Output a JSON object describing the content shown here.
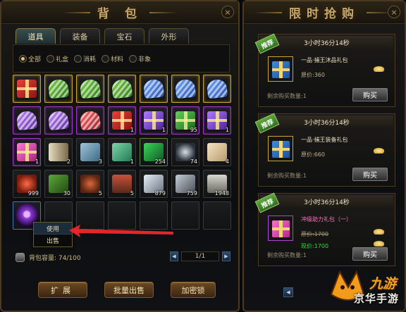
{
  "bag": {
    "title": "背 包",
    "close_label": "×",
    "tabs": [
      {
        "label": "道具",
        "active": true
      },
      {
        "label": "装备",
        "active": false
      },
      {
        "label": "宝石",
        "active": false
      },
      {
        "label": "外形",
        "active": false
      }
    ],
    "filters": [
      {
        "label": "全部",
        "selected": true
      },
      {
        "label": "礼盒",
        "selected": false
      },
      {
        "label": "消耗",
        "selected": false
      },
      {
        "label": "材料",
        "selected": false
      },
      {
        "label": "非象",
        "selected": false
      }
    ],
    "slots": [
      {
        "icon": "red-gift-box-icon",
        "quality": "gold",
        "count": ""
      },
      {
        "icon": "green-heart-gift-icon",
        "quality": "gold",
        "count": ""
      },
      {
        "icon": "green-heart-gift-icon",
        "quality": "gold",
        "count": ""
      },
      {
        "icon": "green-heart-gift-icon",
        "quality": "gold",
        "count": ""
      },
      {
        "icon": "blue-heart-gift-icon",
        "quality": "gold",
        "count": ""
      },
      {
        "icon": "blue-heart-gift-icon",
        "quality": "gold",
        "count": ""
      },
      {
        "icon": "blue-heart-gift-icon",
        "quality": "gold",
        "count": ""
      },
      {
        "icon": "purple-heart-gift-icon",
        "quality": "purple",
        "count": ""
      },
      {
        "icon": "purple-heart-gift-icon",
        "quality": "purple",
        "count": ""
      },
      {
        "icon": "red-heart-gift-icon",
        "quality": "purple",
        "count": ""
      },
      {
        "icon": "red-gift-box-icon",
        "quality": "purple",
        "count": "1"
      },
      {
        "icon": "purple-gift-box-icon",
        "quality": "purple",
        "count": "1"
      },
      {
        "icon": "green-gift-box-icon",
        "quality": "purple",
        "count": "95"
      },
      {
        "icon": "purple-gift-box-icon",
        "quality": "purple",
        "count": "1"
      },
      {
        "icon": "pink-gift-box-icon",
        "quality": "purple",
        "count": "1"
      },
      {
        "icon": "horn-icon",
        "quality": "none",
        "count": "2"
      },
      {
        "icon": "blue-tag-icon",
        "quality": "none",
        "count": "3"
      },
      {
        "icon": "green-ticket-icon",
        "quality": "none",
        "count": "1"
      },
      {
        "icon": "exp-scroll-icon",
        "quality": "green",
        "count": "254"
      },
      {
        "icon": "dark-orb-icon",
        "quality": "none",
        "count": "74"
      },
      {
        "icon": "letter-icon",
        "quality": "none",
        "count": "4"
      },
      {
        "icon": "red-berries-icon",
        "quality": "none",
        "count": "999"
      },
      {
        "icon": "herb-icon",
        "quality": "none",
        "count": "30"
      },
      {
        "icon": "fruit-icon",
        "quality": "none",
        "count": "5"
      },
      {
        "icon": "mushroom-icon",
        "quality": "none",
        "count": "5"
      },
      {
        "icon": "silver-ore-icon",
        "quality": "none",
        "count": "879"
      },
      {
        "icon": "iron-ore-icon",
        "quality": "none",
        "count": "759"
      },
      {
        "icon": "stone-pot-icon",
        "quality": "none",
        "count": "1948"
      },
      {
        "icon": "purple-rune-icon",
        "quality": "blue",
        "count": ""
      },
      {
        "icon": "",
        "quality": "none",
        "count": ""
      },
      {
        "icon": "",
        "quality": "none",
        "count": ""
      },
      {
        "icon": "",
        "quality": "none",
        "count": ""
      },
      {
        "icon": "",
        "quality": "none",
        "count": ""
      },
      {
        "icon": "",
        "quality": "none",
        "count": ""
      },
      {
        "icon": "",
        "quality": "none",
        "count": ""
      }
    ],
    "context_menu": {
      "use_label": "使用",
      "sell_label": "出售"
    },
    "capacity_label": "背包容量: 74/100",
    "pager": {
      "prev": "◀",
      "page": "1/1",
      "next": "▶"
    },
    "buttons": {
      "expand": "扩展",
      "bulk_sell": "批量出售",
      "lock": "加密锁"
    }
  },
  "shop": {
    "title": "限时抢购",
    "close_label": "×",
    "ribbon_label": "推荐",
    "deals": [
      {
        "timer": "3小时36分14秒",
        "name": "一品·捕王沐品礼包",
        "name_color": "normal",
        "price": "原价:360",
        "price_struck": false,
        "sale_price": "",
        "remain": "剩余购买数量:1",
        "buy": "购买",
        "icon": "gift-box-icon",
        "icon_quality": "gold"
      },
      {
        "timer": "3小时36分14秒",
        "name": "一品·捕王装备礼包",
        "name_color": "normal",
        "price": "原价:660",
        "price_struck": false,
        "sale_price": "",
        "remain": "剩余购买数量:1",
        "buy": "购买",
        "icon": "gift-box-icon",
        "icon_quality": "gold"
      },
      {
        "timer": "3小时36分14秒",
        "name": "冲级助力礼包（一）",
        "name_color": "pink",
        "price": "原价:1700",
        "price_struck": true,
        "sale_price": "现价:1700",
        "remain": "剩余购买数量:1",
        "buy": "购买",
        "icon": "pink-gift-box-icon",
        "icon_quality": "purple"
      }
    ],
    "nav_prev": "◀"
  },
  "watermark": {
    "logo": "九游",
    "text": "京华手游"
  }
}
